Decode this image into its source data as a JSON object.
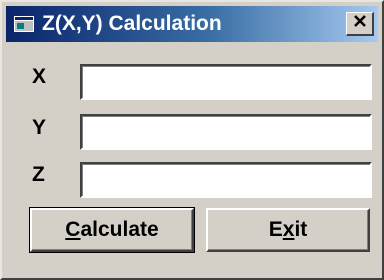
{
  "window": {
    "title": "Z(X,Y) Calculation",
    "close_glyph": "X"
  },
  "fields": [
    {
      "label": "X",
      "value": ""
    },
    {
      "label": "Y",
      "value": ""
    },
    {
      "label": "Z",
      "value": ""
    }
  ],
  "buttons": {
    "calculate": {
      "label": "Calculate",
      "mnemonic": "C",
      "rest": "alculate"
    },
    "exit": {
      "label": "Exit",
      "pre": "E",
      "mnemonic": "x",
      "rest": "it"
    }
  },
  "colors": {
    "titlebar_start": "#0a246a",
    "titlebar_end": "#a6caf0",
    "face": "#d4d0c8"
  },
  "icons": {
    "app": "window-app-icon",
    "close": "close-icon"
  }
}
